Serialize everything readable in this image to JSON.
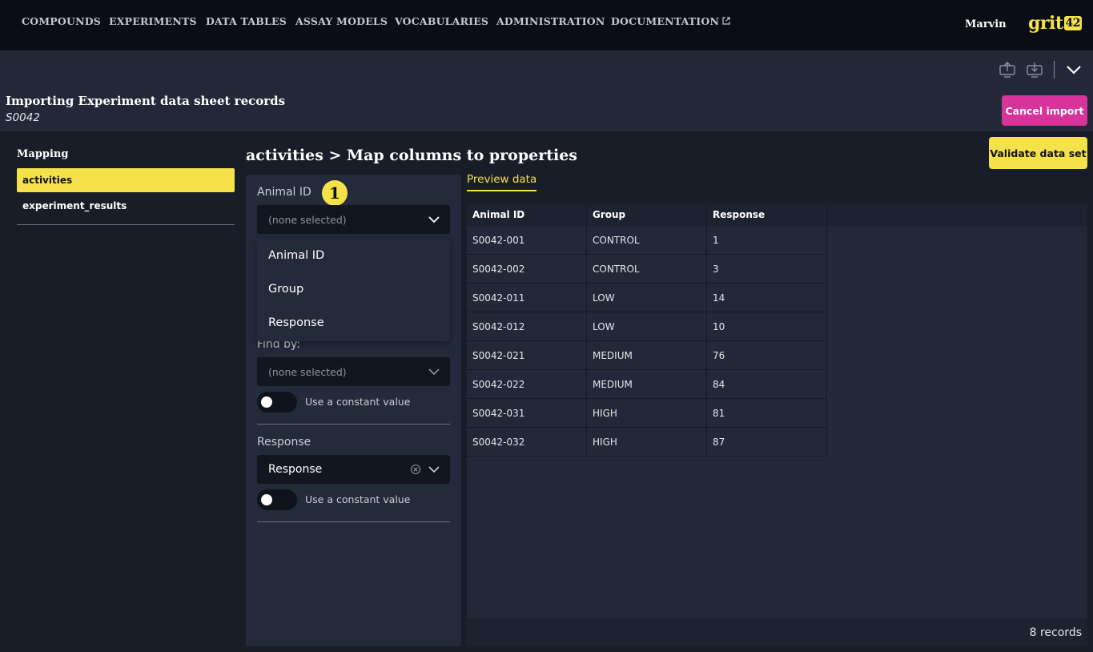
{
  "nav": {
    "items": [
      "COMPOUNDS",
      "EXPERIMENTS",
      "DATA TABLES",
      "ASSAY MODELS",
      "VOCABULARIES",
      "ADMINISTRATION",
      "DOCUMENTATION"
    ],
    "user": "Marvin",
    "logo_text": "grit",
    "logo_number": "42"
  },
  "header": {
    "title": "Importing Experiment data sheet records",
    "subtitle": "S0042",
    "cancel_label": "Cancel import"
  },
  "mapping": {
    "title": "Mapping",
    "items": [
      "activities",
      "experiment_results"
    ],
    "active_index": 0
  },
  "section_title": "activities > Map columns to properties",
  "validate_label": "Validate data set",
  "form": {
    "animal_id_label": "Animal ID",
    "badge": "1",
    "animal_id_placeholder": "(none selected)",
    "dropdown_options": [
      "Animal ID",
      "Group",
      "Response"
    ],
    "find_by_label": "Find by:",
    "find_by_placeholder": "(none selected)",
    "constant_label": "Use a constant value",
    "response_label": "Response",
    "response_value": "Response"
  },
  "preview": {
    "tab": "Preview data",
    "columns": [
      "Animal ID",
      "Group",
      "Response"
    ],
    "rows": [
      [
        "S0042-001",
        "CONTROL",
        "1"
      ],
      [
        "S0042-002",
        "CONTROL",
        "3"
      ],
      [
        "S0042-011",
        "LOW",
        "14"
      ],
      [
        "S0042-012",
        "LOW",
        "10"
      ],
      [
        "S0042-021",
        "MEDIUM",
        "76"
      ],
      [
        "S0042-022",
        "MEDIUM",
        "84"
      ],
      [
        "S0042-031",
        "HIGH",
        "81"
      ],
      [
        "S0042-032",
        "HIGH",
        "87"
      ]
    ],
    "records_label": "8 records"
  },
  "colors": {
    "accent": "#f5e24a",
    "danger": "#d6339b",
    "background": "#181d27"
  },
  "icons": [
    "external-link-icon",
    "upload-icon",
    "download-icon",
    "chevron-down-icon",
    "clear-icon"
  ]
}
